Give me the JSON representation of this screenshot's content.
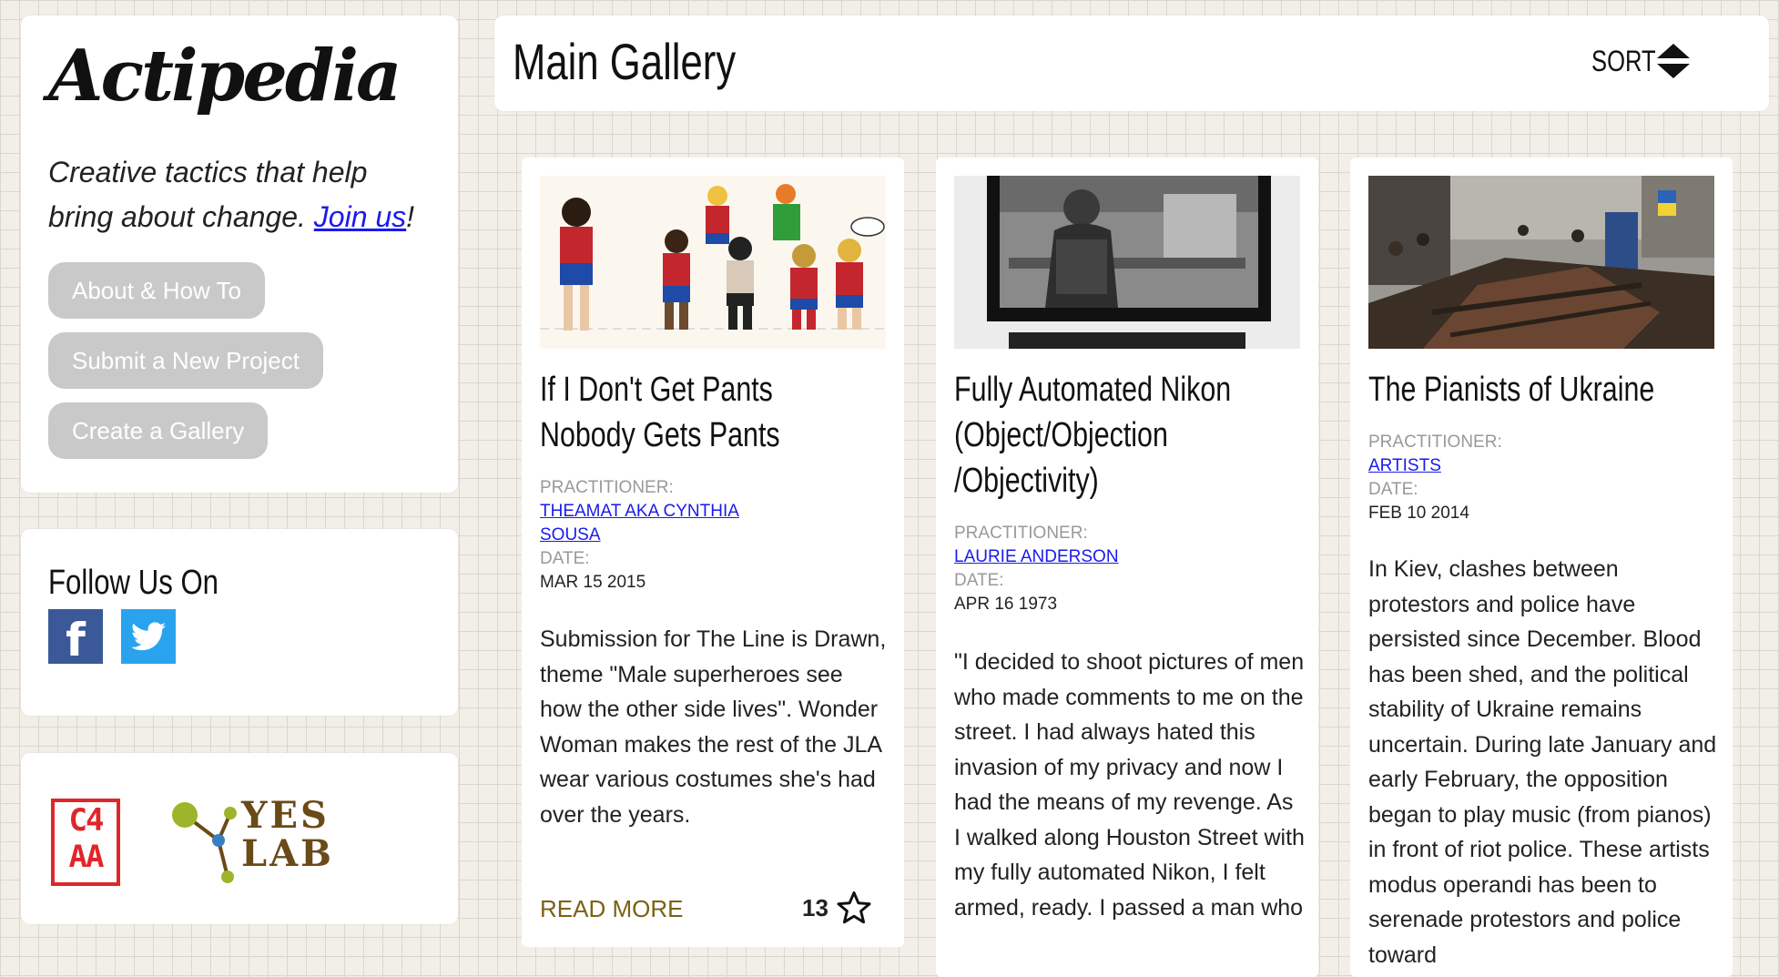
{
  "sidebar": {
    "logo": "Actipedia",
    "tagline_prefix": "Creative tactics that help bring about change. ",
    "join_link": "Join us",
    "tagline_suffix": "!",
    "buttons": [
      {
        "label": "About & How To"
      },
      {
        "label": "Submit a New Project"
      },
      {
        "label": "Create a Gallery"
      }
    ],
    "follow_title": "Follow Us On",
    "social": [
      {
        "icon": "facebook-icon",
        "color": "#3b5998"
      },
      {
        "icon": "twitter-icon",
        "color": "#2aa3ef"
      }
    ],
    "partners": {
      "c4aa_line1": "C4",
      "c4aa_line2": "AA",
      "yeslab_line1": "YES",
      "yeslab_line2": "LAB"
    }
  },
  "header": {
    "title": "Main Gallery",
    "sort_label": "SORT"
  },
  "labels": {
    "practitioner": "PRACTITIONER:",
    "date": "DATE:",
    "read_more": "READ MORE"
  },
  "cards": [
    {
      "title": "If I Don't Get Pants Nobody Gets Pants",
      "practitioner_line1": "THEAMAT AKA CYNTHIA",
      "practitioner_line2": "SOUSA",
      "date": "MAR 15 2015",
      "description": "Submission for The Line is Drawn, theme \"Male superheroes see how the other side lives\". Wonder Woman makes the rest of the JLA wear various costumes she's had over the years.",
      "favorites": "13"
    },
    {
      "title": "Fully Automated Nikon (Object/Objection /Objectivity)",
      "practitioner_line1": "LAURIE ANDERSON",
      "date": "APR 16 1973",
      "description": "\"I decided to shoot pictures of men who made comments to me on the street. I had always hated this invasion of my privacy and now I had the means of my revenge. As I walked along Houston Street with my fully automated Nikon, I felt armed, ready. I passed a man who"
    },
    {
      "title": "The Pianists of Ukraine",
      "practitioner_line1": "ARTISTS",
      "date": "FEB 10 2014",
      "description": "In Kiev, clashes between protestors and police have persisted since December. Blood has been shed, and the political stability of Ukraine remains uncertain. During late January and early February, the opposition began to play music (from pianos) in front of riot police. These artists modus operandi has been to serenade protestors and police toward"
    }
  ],
  "colors": {
    "background": "#f1efe7",
    "button_gray": "#c9c9c9",
    "link_blue": "#1a1aee",
    "read_more_gold": "#7a6214"
  }
}
